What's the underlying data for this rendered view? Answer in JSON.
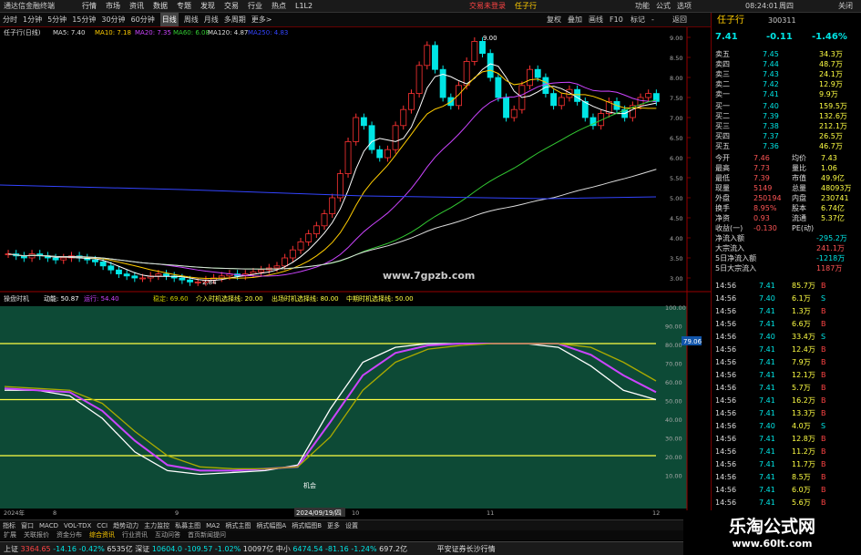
{
  "window": {
    "title": "通达信金融终端",
    "login": "交易未登录",
    "stock_name": "任子行"
  },
  "menu": [
    "行情",
    "市场",
    "资讯",
    "数据",
    "专题",
    "发现",
    "交易",
    "行业",
    "热点",
    "L1L2"
  ],
  "menu_right": [
    "功能",
    "公式",
    "选项",
    "08:24:01",
    "周四",
    "关闭"
  ],
  "periods": [
    "分时",
    "1分钟",
    "5分钟",
    "15分钟",
    "30分钟",
    "60分钟",
    "日线",
    "周线",
    "月线",
    "多周期",
    "更多>"
  ],
  "tools": [
    "复权",
    "叠加",
    "画线",
    "F10",
    "标记",
    "-",
    "返回"
  ],
  "ma_line": {
    "label": "任子行(日线)",
    "ma5": "MA5: 7.40",
    "ma10": "MA10: 7.18",
    "ma20": "MA20: 7.35",
    "ma60": "MA60: 6.08",
    "ma120": "MA120: 4.87",
    "ma250": "MA250: 4.83"
  },
  "price_axis": [
    "9.00",
    "8.50",
    "8.00",
    "7.50",
    "7.00",
    "6.50",
    "6.00",
    "5.50",
    "5.00",
    "4.50",
    "4.00",
    "3.50",
    "3.00"
  ],
  "osc_axis": [
    "100.00",
    "90.00",
    "80.00",
    "70.00",
    "60.00",
    "50.00",
    "40.00",
    "30.00",
    "20.00",
    "10.00"
  ],
  "osc_label": {
    "name": "操盘时机",
    "a": "动能: 50.87",
    "b": "运行: 54.40",
    "c": "稳定: 69.60",
    "d": "介入时机选择线: 20.00",
    "e": "出场时机选择线: 80.00",
    "f": "中期时机选择线: 50.00"
  },
  "osc_value": "79.06",
  "annot": {
    "high": "9.00",
    "low": "2.84",
    "note": "机会",
    "watermark": "www.7gpzb.com",
    "date": "2024/09/19/四"
  },
  "date_axis": [
    "2024年",
    "8",
    "9",
    "10",
    "11",
    "12"
  ],
  "chart_data": {
    "type": "line",
    "title": "",
    "series": [
      {
        "name": "动能",
        "values": [
          55,
          55,
          52,
          40,
          22,
          12,
          10,
          11,
          12,
          15,
          45,
          70,
          78,
          80,
          80,
          80,
          80,
          78,
          68,
          55,
          50
        ]
      },
      {
        "name": "运行",
        "values": [
          56,
          55,
          54,
          44,
          28,
          15,
          12,
          12,
          13,
          14,
          38,
          63,
          75,
          79,
          80,
          80,
          80,
          80,
          74,
          63,
          54
        ]
      },
      {
        "name": "稳定",
        "values": [
          57,
          56,
          55,
          48,
          33,
          20,
          14,
          13,
          13,
          14,
          30,
          55,
          70,
          77,
          79,
          80,
          80,
          80,
          78,
          70,
          60
        ]
      }
    ]
  },
  "quote": {
    "code": "300311",
    "price": "7.41",
    "change": "-0.11",
    "pct": "-1.46%",
    "asks": [
      [
        "卖五",
        "7.45",
        "34.3万"
      ],
      [
        "卖四",
        "7.44",
        "48.7万"
      ],
      [
        "卖三",
        "7.43",
        "24.1万"
      ],
      [
        "卖二",
        "7.42",
        "12.9万"
      ],
      [
        "卖一",
        "7.41",
        "9.9万"
      ]
    ],
    "bids": [
      [
        "买一",
        "7.40",
        "159.5万"
      ],
      [
        "买二",
        "7.39",
        "132.6万"
      ],
      [
        "买三",
        "7.38",
        "212.1万"
      ],
      [
        "买四",
        "7.37",
        "26.5万"
      ],
      [
        "买五",
        "7.36",
        "46.7万"
      ]
    ],
    "stats": [
      [
        "今开",
        "7.46",
        "均价",
        "7.43"
      ],
      [
        "最高",
        "7.73",
        "量比",
        "1.06"
      ],
      [
        "最低",
        "7.39",
        "市值",
        "49.9亿"
      ],
      [
        "现量",
        "5149",
        "总量",
        "48093万"
      ],
      [
        "外盘",
        "250194",
        "内盘",
        "230741"
      ],
      [
        "换手",
        "8.95%",
        "股本",
        "6.74亿"
      ],
      [
        "净资",
        "0.93",
        "流通",
        "5.37亿"
      ],
      [
        "收益(一)",
        "-0.130",
        "PE(动)",
        ""
      ]
    ],
    "flows": [
      [
        "净流入额",
        "-295.2万"
      ],
      [
        "大宗流入",
        "241.1万"
      ],
      [
        "5日净流入额",
        "-1218万"
      ],
      [
        "5日大宗流入",
        "1187万"
      ]
    ],
    "ticks": [
      [
        "14:56",
        "7.41",
        "85.7万",
        "B"
      ],
      [
        "14:56",
        "7.40",
        "6.1万",
        "S"
      ],
      [
        "14:56",
        "7.41",
        "1.3万",
        "B"
      ],
      [
        "14:56",
        "7.41",
        "6.6万",
        "B"
      ],
      [
        "14:56",
        "7.40",
        "33.4万",
        "S"
      ],
      [
        "14:56",
        "7.41",
        "12.4万",
        "B"
      ],
      [
        "14:56",
        "7.41",
        "7.9万",
        "B"
      ],
      [
        "14:56",
        "7.41",
        "12.1万",
        "B"
      ],
      [
        "14:56",
        "7.41",
        "5.7万",
        "B"
      ],
      [
        "14:56",
        "7.41",
        "16.2万",
        "B"
      ],
      [
        "14:56",
        "7.41",
        "13.3万",
        "B"
      ],
      [
        "14:56",
        "7.40",
        "4.0万",
        "S"
      ],
      [
        "14:56",
        "7.41",
        "12.8万",
        "B"
      ],
      [
        "14:56",
        "7.41",
        "11.2万",
        "B"
      ],
      [
        "14:56",
        "7.41",
        "11.7万",
        "B"
      ],
      [
        "14:56",
        "7.41",
        "8.5万",
        "B"
      ],
      [
        "14:56",
        "7.41",
        "6.0万",
        "B"
      ],
      [
        "14:56",
        "7.41",
        "5.6万",
        "B"
      ]
    ]
  },
  "indicators": [
    "指标",
    "窗口",
    "MACD",
    "VOL-TDX",
    "CCI",
    "趋势动力",
    "主力监控",
    "私募主图",
    "MA2",
    "柄式主图",
    "柄式幅图A",
    "柄式幅图B",
    "更多",
    "设置"
  ],
  "tabs2": [
    "扩展",
    "关联报价",
    "资金分布",
    "综合资讯",
    "行业资讯",
    "互动问答",
    "首页新闻提问"
  ],
  "status": {
    "sh_label": "上证",
    "sh": "3364.65",
    "sh_chg": "-14.16",
    "sh_pct": "-0.42%",
    "sh_amt": "6535亿",
    "sz_label": "深证",
    "sz": "10604.0",
    "sz_chg": "-109.57",
    "sz_pct": "-1.02%",
    "sz_amt": "10097亿",
    "zx_label": "中小",
    "zx": "6474.54",
    "zx_chg": "-81.16",
    "zx_pct": "-1.24%",
    "zx_amt": "697.2亿",
    "broker": "平安证券长沙行情"
  },
  "logo": {
    "title": "乐淘公式网",
    "url": "www.60lt.com"
  },
  "colors": {
    "up": "#ff3333",
    "down": "#00e5e5",
    "yellow": "#ffff44",
    "osc_bg": "#0d4a36"
  }
}
